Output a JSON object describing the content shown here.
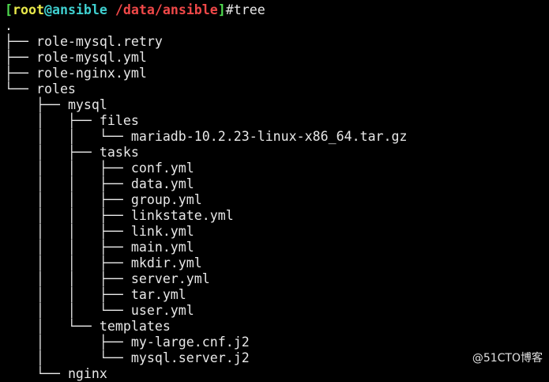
{
  "prompt": {
    "open_bracket": "[",
    "user": "root",
    "at": "@",
    "host": "ansible",
    "path": "/data/ansible",
    "close_bracket": "]",
    "command": "#tree"
  },
  "tree": [
    {
      "prefix": "",
      "name": "."
    },
    {
      "prefix": "├── ",
      "name": "role-mysql.retry"
    },
    {
      "prefix": "├── ",
      "name": "role-mysql.yml"
    },
    {
      "prefix": "├── ",
      "name": "role-nginx.yml"
    },
    {
      "prefix": "└── ",
      "name": "roles"
    },
    {
      "prefix": "    ├── ",
      "name": "mysql"
    },
    {
      "prefix": "    │   ├── ",
      "name": "files"
    },
    {
      "prefix": "    │   │   └── ",
      "name": "mariadb-10.2.23-linux-x86_64.tar.gz"
    },
    {
      "prefix": "    │   ├── ",
      "name": "tasks"
    },
    {
      "prefix": "    │   │   ├── ",
      "name": "conf.yml"
    },
    {
      "prefix": "    │   │   ├── ",
      "name": "data.yml"
    },
    {
      "prefix": "    │   │   ├── ",
      "name": "group.yml"
    },
    {
      "prefix": "    │   │   ├── ",
      "name": "linkstate.yml"
    },
    {
      "prefix": "    │   │   ├── ",
      "name": "link.yml"
    },
    {
      "prefix": "    │   │   ├── ",
      "name": "main.yml"
    },
    {
      "prefix": "    │   │   ├── ",
      "name": "mkdir.yml"
    },
    {
      "prefix": "    │   │   ├── ",
      "name": "server.yml"
    },
    {
      "prefix": "    │   │   ├── ",
      "name": "tar.yml"
    },
    {
      "prefix": "    │   │   └── ",
      "name": "user.yml"
    },
    {
      "prefix": "    │   └── ",
      "name": "templates"
    },
    {
      "prefix": "    │       ├── ",
      "name": "my-large.cnf.j2"
    },
    {
      "prefix": "    │       └── ",
      "name": "mysql.server.j2"
    },
    {
      "prefix": "    └── ",
      "name": "nginx"
    }
  ],
  "watermark": "@51CTO博客"
}
